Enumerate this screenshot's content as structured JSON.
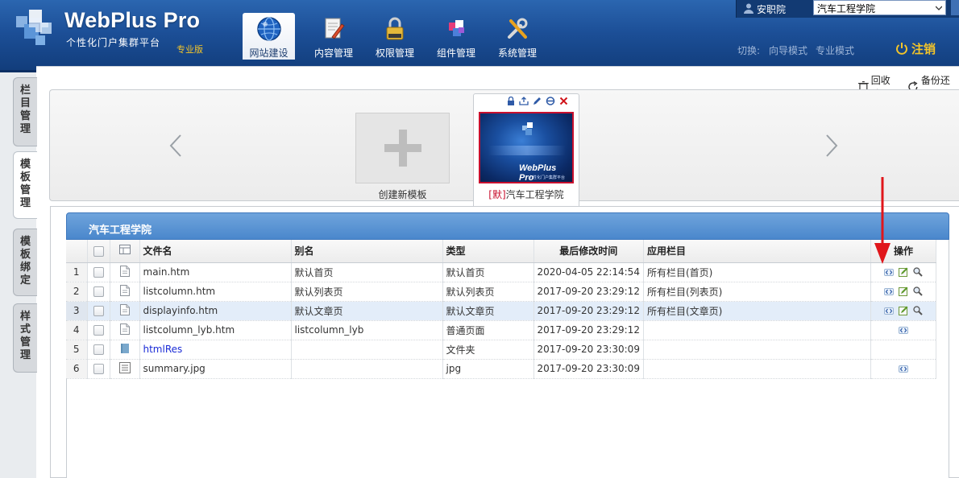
{
  "brand": {
    "name": "WebPlus Pro",
    "subtitle": "个性化门户集群平台",
    "edition": "专业版"
  },
  "nav": [
    {
      "label": "网站建设",
      "icon": "globe-icon",
      "active": true
    },
    {
      "label": "内容管理",
      "icon": "document-pen-icon",
      "active": false
    },
    {
      "label": "权限管理",
      "icon": "lock-icon",
      "active": false
    },
    {
      "label": "组件管理",
      "icon": "puzzle-icon",
      "active": false
    },
    {
      "label": "系统管理",
      "icon": "tools-icon",
      "active": false
    }
  ],
  "user": {
    "role": "安职院",
    "college": "汽车工程学院"
  },
  "mode_switch": {
    "label": "切换:",
    "wizard": "向导模式",
    "pro": "专业模式"
  },
  "logout_label": "注销",
  "sidebar_tabs": [
    {
      "label": "栏目管理",
      "active": false
    },
    {
      "label": "模板管理",
      "active": true
    },
    {
      "label": "模板绑定",
      "active": false
    },
    {
      "label": "样式管理",
      "active": false
    }
  ],
  "toolbar": {
    "recycle_label": "回收站",
    "backup_label": "备份还原"
  },
  "carousel": {
    "new_template_label": "创建新模板",
    "template": {
      "default_tag": "[默]",
      "name": "汽车工程学院",
      "thumb_brand": "WebPlus Pro",
      "thumb_sub": "个性化门户集群平台"
    }
  },
  "panel": {
    "title": "汽车工程学院"
  },
  "table": {
    "headers": {
      "filename": "文件名",
      "alias": "别名",
      "type": "类型",
      "modified": "最后修改时间",
      "column": "应用栏目",
      "ops": "操作"
    },
    "rows": [
      {
        "num": "1",
        "filename": "main.htm",
        "alias": "默认首页",
        "type": "默认首页",
        "modified": "2020-04-05 22:14:54",
        "column": "所有栏目(首页)",
        "icon": "page-icon",
        "ops": [
          "code",
          "edit",
          "view"
        ],
        "selected": false,
        "link": false
      },
      {
        "num": "2",
        "filename": "listcolumn.htm",
        "alias": "默认列表页",
        "type": "默认列表页",
        "modified": "2017-09-20 23:29:12",
        "column": "所有栏目(列表页)",
        "icon": "page-icon",
        "ops": [
          "code",
          "edit",
          "view"
        ],
        "selected": false,
        "link": false
      },
      {
        "num": "3",
        "filename": "displayinfo.htm",
        "alias": "默认文章页",
        "type": "默认文章页",
        "modified": "2017-09-20 23:29:12",
        "column": "所有栏目(文章页)",
        "icon": "page-icon",
        "ops": [
          "code",
          "edit",
          "view"
        ],
        "selected": true,
        "link": false
      },
      {
        "num": "4",
        "filename": "listcolumn_lyb.htm",
        "alias": "listcolumn_lyb",
        "type": "普通页面",
        "modified": "2017-09-20 23:29:12",
        "column": "",
        "icon": "page-icon",
        "ops": [
          "code"
        ],
        "selected": false,
        "link": false
      },
      {
        "num": "5",
        "filename": "htmlRes",
        "alias": "",
        "type": "文件夹",
        "modified": "2017-09-20 23:30:09",
        "column": "",
        "icon": "folder-icon",
        "ops": [],
        "selected": false,
        "link": true
      },
      {
        "num": "6",
        "filename": "summary.jpg",
        "alias": "",
        "type": "jpg",
        "modified": "2017-09-20 23:30:09",
        "column": "",
        "icon": "image-file-icon",
        "ops": [
          "code"
        ],
        "selected": false,
        "link": false
      }
    ]
  },
  "colors": {
    "header_top": "#2b66b0",
    "header_bottom": "#113c7a",
    "accent_gold": "#f3c42a",
    "panel_blue": "#4a87cc",
    "annotation_red": "#e0161b",
    "link_blue": "#1a2bd6"
  }
}
